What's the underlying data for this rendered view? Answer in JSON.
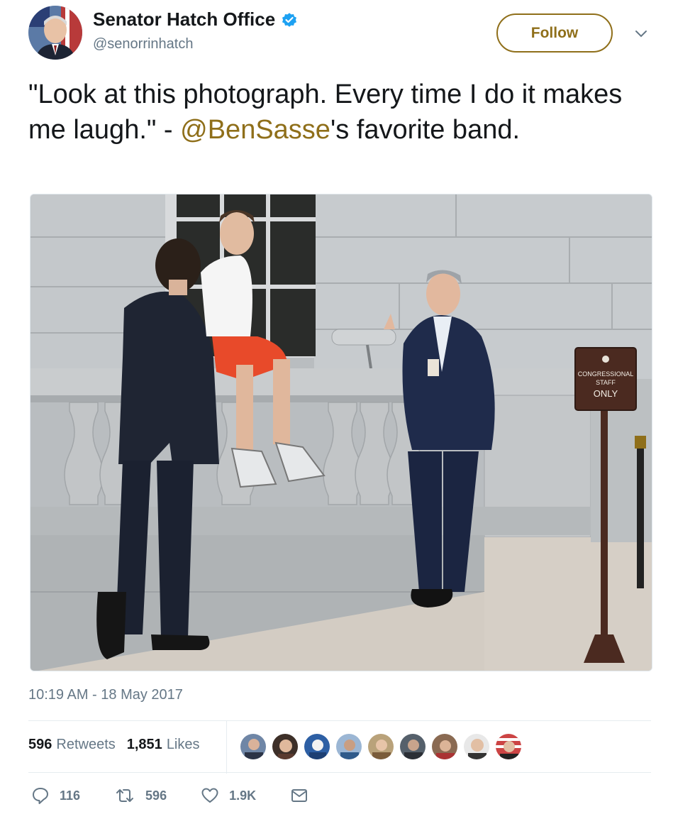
{
  "account": {
    "display_name": "Senator Hatch Office",
    "handle": "@senorrinhatch",
    "verified": true
  },
  "follow_label": "Follow",
  "tweet": {
    "text_before": "\"Look at this photograph. Every time I do it makes me laugh.\" - ",
    "mention": "@BenSasse",
    "text_after": "'s favorite band."
  },
  "photo": {
    "sign_line1": "CONGRESSIONAL",
    "sign_line2": "STAFF",
    "sign_line3": "ONLY"
  },
  "timestamp": "10:19 AM - 18 May 2017",
  "stats": {
    "retweets_count": "596",
    "retweets_label": "Retweets",
    "likes_count": "1,851",
    "likes_label": "Likes"
  },
  "actions": {
    "replies": "116",
    "retweets": "596",
    "likes": "1.9K"
  },
  "colors": {
    "accent": "#8f6f1a",
    "verified": "#1da1f2",
    "muted": "#657786"
  }
}
